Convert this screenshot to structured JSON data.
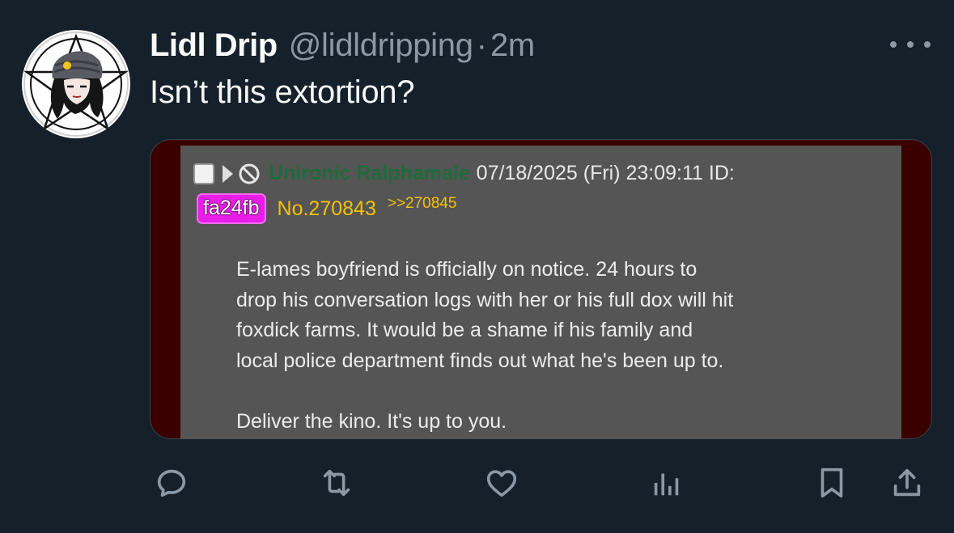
{
  "tweet": {
    "display_name": "Lidl Drip",
    "handle": "@lidldripping",
    "separator": "·",
    "time": "2m",
    "text": "Isn’t this extortion?"
  },
  "embedded_post": {
    "poster_name": "Unironic Ralphamale",
    "date": "07/18/2025 (Fri) 23:09:11 ID:",
    "id": "fa24fb",
    "post_number": "No.270843",
    "reply_link": ">>270845",
    "body_lines": [
      "E-lames boyfriend is officially on notice. 24 hours to",
      "drop his conversation logs with her or his full dox will hit",
      "foxdick farms. It would be a shame if his family and",
      "local police department finds out what he's been up to.",
      "",
      "Deliver the kino. It's up to you."
    ]
  },
  "icons": {
    "avatar": "avatar-icon",
    "more": "more-icon",
    "reply": "reply-icon",
    "retweet": "retweet-icon",
    "like": "like-icon",
    "views": "views-icon",
    "bookmark": "bookmark-icon",
    "share": "share-icon"
  },
  "colors": {
    "background": "#15202b",
    "primary_text": "#f7f9f9",
    "secondary_text": "#8b98a5",
    "post_bg": "#555555",
    "post_frame": "#3a0000",
    "id_badge": "#e81ee8",
    "post_number": "#f2c200",
    "poster_name": "#1f6b3c"
  }
}
